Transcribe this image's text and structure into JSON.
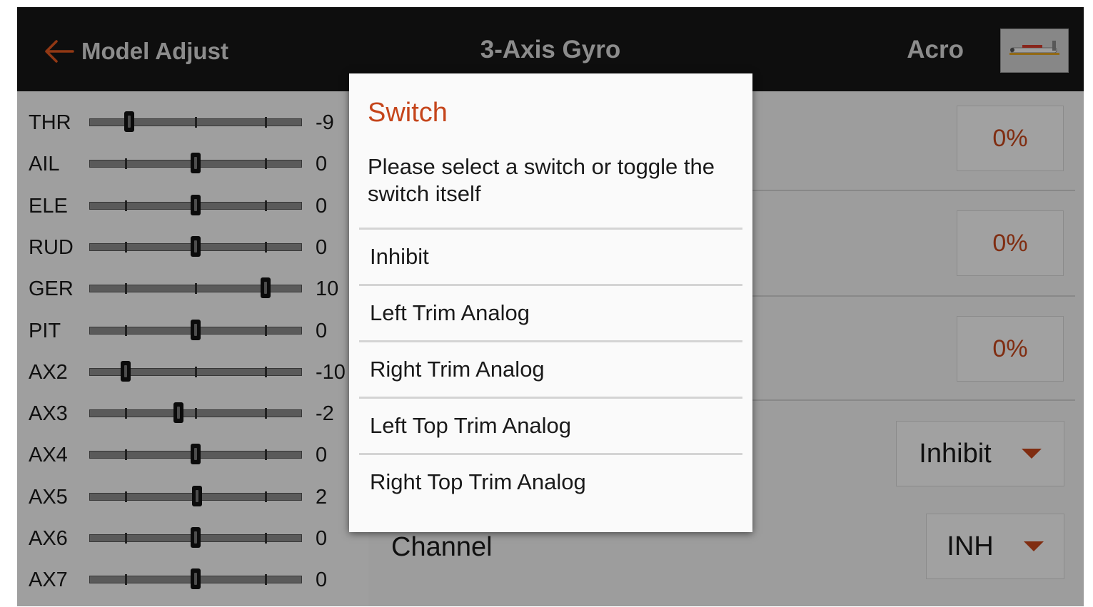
{
  "header": {
    "back_label": "Model Adjust",
    "title": "3-Axis Gyro",
    "model_name": "Acro",
    "back_icon": "arrow-left-icon",
    "accent_color": "#e0561f"
  },
  "channel_monitor": {
    "channels": [
      {
        "label": "THR",
        "value": "-9",
        "level": -0.95
      },
      {
        "label": "AIL",
        "value": "0",
        "level": 0
      },
      {
        "label": "ELE",
        "value": "0",
        "level": 0
      },
      {
        "label": "RUD",
        "value": "0",
        "level": 0
      },
      {
        "label": "GER",
        "value": "10",
        "level": 1.0
      },
      {
        "label": "PIT",
        "value": "0",
        "level": 0
      },
      {
        "label": "AX2",
        "value": "-10",
        "level": -1.0
      },
      {
        "label": "AX3",
        "value": "-2",
        "level": -0.25
      },
      {
        "label": "AX4",
        "value": "0",
        "level": 0
      },
      {
        "label": "AX5",
        "value": "2",
        "level": 0.02
      },
      {
        "label": "AX6",
        "value": "0",
        "level": 0
      },
      {
        "label": "AX7",
        "value": "0",
        "level": 0
      }
    ]
  },
  "settings": {
    "gain_values": [
      "0%",
      "0%",
      "0%"
    ],
    "switch_select": "Inhibit",
    "channel_label": "Channel",
    "channel_select": "INH",
    "value_color": "#c5451b"
  },
  "dialog": {
    "title": "Switch",
    "message": "Please select a switch or toggle the switch itself",
    "options": [
      "Inhibit",
      "Left Trim Analog",
      "Right Trim Analog",
      "Left Top Trim Analog",
      "Right Top Trim Analog"
    ]
  }
}
